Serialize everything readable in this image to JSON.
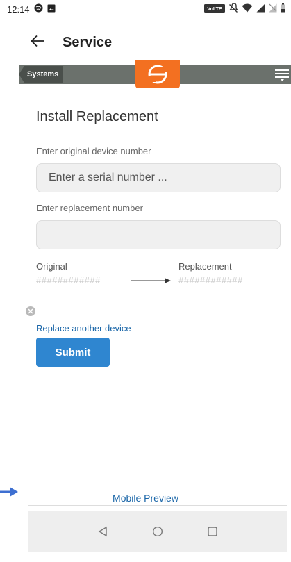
{
  "status_bar": {
    "time": "12:14",
    "volte_label": "VoLTE",
    "icons": [
      "spotify-icon",
      "image-icon",
      "volte-icon",
      "mute-icon",
      "wifi-icon",
      "signal-icon",
      "no-signal-icon",
      "battery-icon"
    ]
  },
  "app_bar": {
    "title": "Service",
    "back_icon": "arrow-left-icon"
  },
  "toolbar": {
    "systems_label": "Systems",
    "logo_icon": "enphase-logo",
    "menu_icon": "menu-icon"
  },
  "form": {
    "title": "Install Replacement",
    "original_label": "Enter original device number",
    "original_placeholder": "Enter a serial number ...",
    "original_value": "",
    "replacement_label": "Enter replacement number",
    "replacement_placeholder": "",
    "replacement_value": ""
  },
  "comparison": {
    "original_label": "Original",
    "original_value": "############",
    "replacement_label": "Replacement",
    "replacement_value": "############"
  },
  "actions": {
    "replace_another_label": "Replace another device",
    "submit_label": "Submit"
  },
  "footer": {
    "mobile_preview_label": "Mobile Preview"
  },
  "colors": {
    "brand_orange": "#f37021",
    "toolbar_gray": "#6b716c",
    "primary_blue": "#2f86d0",
    "link_blue": "#1a66a8"
  }
}
